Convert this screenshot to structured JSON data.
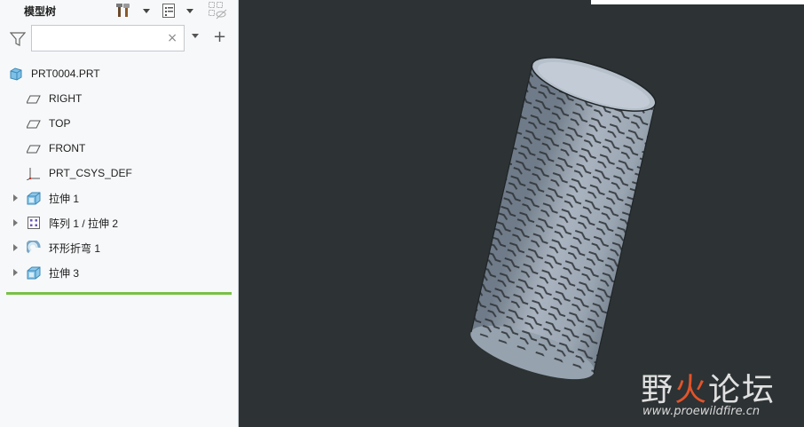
{
  "panel": {
    "title": "模型树",
    "search": {
      "value": "",
      "placeholder": ""
    }
  },
  "tree": {
    "root": "PRT0004.PRT",
    "items": [
      {
        "label": "RIGHT",
        "icon": "datum-plane-icon",
        "expandable": false
      },
      {
        "label": "TOP",
        "icon": "datum-plane-icon",
        "expandable": false
      },
      {
        "label": "FRONT",
        "icon": "datum-plane-icon",
        "expandable": false
      },
      {
        "label": "PRT_CSYS_DEF",
        "icon": "coordinate-system-icon",
        "expandable": false
      },
      {
        "label": "拉伸 1",
        "icon": "extrude-icon",
        "expandable": true
      },
      {
        "label": "阵列 1 / 拉伸 2",
        "icon": "pattern-icon",
        "expandable": true
      },
      {
        "label": "环形折弯 1",
        "icon": "toroidal-bend-icon",
        "expandable": true
      },
      {
        "label": "拉伸 3",
        "icon": "extrude-icon",
        "expandable": true
      }
    ]
  },
  "watermark": {
    "text_cn_prefix": "野",
    "text_cn_mid": "火",
    "text_cn_suffix": "论坛",
    "url": "www.proewildfire.cn"
  },
  "colors": {
    "viewport_bg": "#2d3234",
    "insert_indicator": "#79c046",
    "model": "#9ba6b3"
  }
}
